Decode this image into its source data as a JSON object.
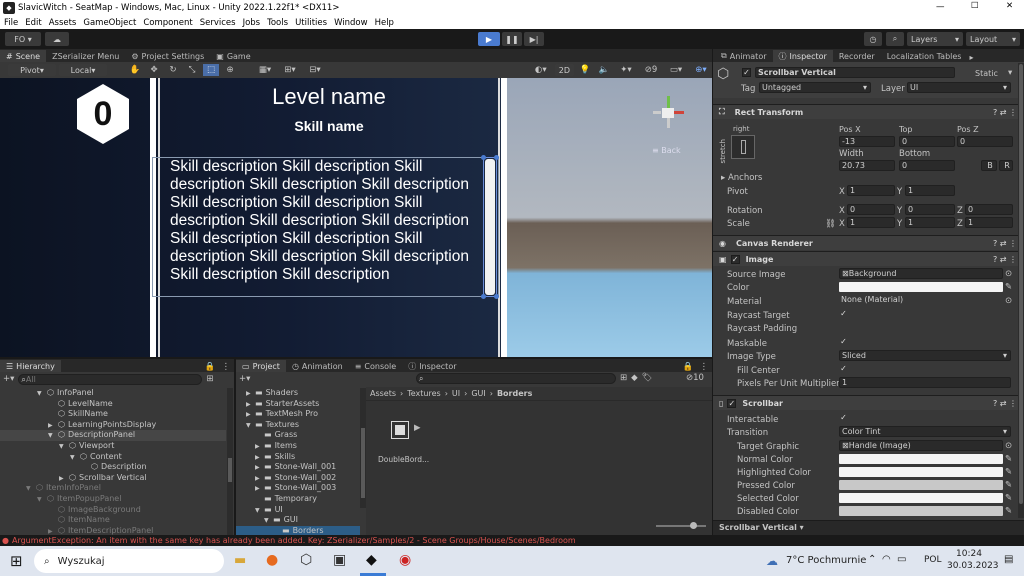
{
  "window": {
    "title": "SlavicWitch - SeatMap - Windows, Mac, Linux - Unity 2022.1.22f1* <DX11>",
    "min": "—",
    "max": "☐",
    "close": "✕"
  },
  "menu": [
    "File",
    "Edit",
    "Assets",
    "GameObject",
    "Component",
    "Services",
    "Jobs",
    "Tools",
    "Utilities",
    "Window",
    "Help"
  ],
  "toolbar": {
    "account": "FO",
    "layers": "Layers",
    "layout": "Layout"
  },
  "scene": {
    "tabs": [
      "Scene",
      "ZSerializer Menu",
      "Project Settings",
      "Game"
    ],
    "pivot": "Pivot",
    "local": "Local",
    "mode2d": "2D",
    "back": "≡ Back",
    "badge": "0",
    "level_name": "Level name",
    "skill_name": "Skill name",
    "description": "Skill description Skill description Skill description Skill description Skill description Skill description Skill description Skill description Skill description Skill description Skill description Skill description Skill description Skill description Skill description Skill description Skill description"
  },
  "inspector": {
    "tabs": [
      "Animator",
      "Inspector",
      "Recorder",
      "Localization Tables"
    ],
    "object_name": "Scrollbar Vertical",
    "static": "Static",
    "tag_label": "Tag",
    "tag": "Untagged",
    "layer_label": "Layer",
    "layer": "UI",
    "rect": {
      "title": "Rect Transform",
      "anchor_h": "right",
      "anchor_v": "stretch",
      "posx_l": "Pos X",
      "top_l": "Top",
      "posz_l": "Pos Z",
      "posx": "-13",
      "top": "0",
      "posz": "0",
      "width_l": "Width",
      "bottom_l": "Bottom",
      "width": "20.73",
      "bottom": "0",
      "anchors": "Anchors",
      "pivot": "Pivot",
      "pivot_x": "1",
      "pivot_y": "1",
      "rotation": "Rotation",
      "rot_x": "0",
      "rot_y": "0",
      "rot_z": "0",
      "scale": "Scale",
      "sc_x": "1",
      "sc_y": "1",
      "sc_z": "1",
      "bp": "B",
      "rp": "R"
    },
    "canvas_renderer": "Canvas Renderer",
    "image": {
      "title": "Image",
      "source_l": "Source Image",
      "source": "Background",
      "color_l": "Color",
      "material_l": "Material",
      "material": "None (Material)",
      "raycast_l": "Raycast Target",
      "padding_l": "Raycast Padding",
      "maskable_l": "Maskable",
      "type_l": "Image Type",
      "type": "Sliced",
      "fill_l": "Fill Center",
      "ppu_l": "Pixels Per Unit Multiplier",
      "ppu": "1"
    },
    "scrollbar": {
      "title": "Scrollbar",
      "interact_l": "Interactable",
      "transition_l": "Transition",
      "transition": "Color Tint",
      "target_l": "Target Graphic",
      "target": "Handle (Image)",
      "normal": "Normal Color",
      "highlighted": "Highlighted Color",
      "pressed": "Pressed Color",
      "selected": "Selected Color",
      "disabled": "Disabled Color"
    },
    "footer": "Scrollbar Vertical ▾"
  },
  "hierarchy": {
    "title": "Hierarchy",
    "search": "All",
    "items": [
      {
        "label": "InfoPanel",
        "indent": 3,
        "arrow": "▼",
        "dim": false
      },
      {
        "label": "LevelName",
        "indent": 4,
        "arrow": "",
        "dim": false
      },
      {
        "label": "SkillName",
        "indent": 4,
        "arrow": "",
        "dim": false
      },
      {
        "label": "LearningPointsDisplay",
        "indent": 4,
        "arrow": "▶",
        "dim": false
      },
      {
        "label": "DescriptionPanel",
        "indent": 4,
        "arrow": "▼",
        "dim": false
      },
      {
        "label": "Viewport",
        "indent": 5,
        "arrow": "▼",
        "dim": false
      },
      {
        "label": "Content",
        "indent": 6,
        "arrow": "▼",
        "dim": false
      },
      {
        "label": "Description",
        "indent": 7,
        "arrow": "",
        "dim": false
      },
      {
        "label": "Scrollbar Vertical",
        "indent": 5,
        "arrow": "▶",
        "dim": false
      },
      {
        "label": "ItemInfoPanel",
        "indent": 2,
        "arrow": "▼",
        "dim": true
      },
      {
        "label": "ItemPopupPanel",
        "indent": 3,
        "arrow": "▼",
        "dim": true
      },
      {
        "label": "ImageBackground",
        "indent": 4,
        "arrow": "",
        "dim": true
      },
      {
        "label": "ItemName",
        "indent": 4,
        "arrow": "",
        "dim": true
      },
      {
        "label": "ItemDescriptionPanel",
        "indent": 4,
        "arrow": "▶",
        "dim": true
      }
    ]
  },
  "project": {
    "tabs": [
      "Project",
      "Animation",
      "Console",
      "Inspector"
    ],
    "tree": [
      {
        "label": "Shaders",
        "indent": 0,
        "arrow": "▶"
      },
      {
        "label": "StarterAssets",
        "indent": 0,
        "arrow": "▶"
      },
      {
        "label": "TextMesh Pro",
        "indent": 0,
        "arrow": "▶"
      },
      {
        "label": "Textures",
        "indent": 0,
        "arrow": "▼"
      },
      {
        "label": "Grass",
        "indent": 1,
        "arrow": ""
      },
      {
        "label": "Items",
        "indent": 1,
        "arrow": "▶"
      },
      {
        "label": "Skills",
        "indent": 1,
        "arrow": "▶"
      },
      {
        "label": "Stone-Wall_001",
        "indent": 1,
        "arrow": "▶"
      },
      {
        "label": "Stone-Wall_002",
        "indent": 1,
        "arrow": "▶"
      },
      {
        "label": "Stone-Wall_003",
        "indent": 1,
        "arrow": "▶"
      },
      {
        "label": "Temporary",
        "indent": 1,
        "arrow": ""
      },
      {
        "label": "UI",
        "indent": 1,
        "arrow": "▼"
      },
      {
        "label": "GUI",
        "indent": 2,
        "arrow": "▼"
      },
      {
        "label": "Borders",
        "indent": 3,
        "arrow": ""
      }
    ],
    "breadcrumb": [
      "Assets",
      "Textures",
      "UI",
      "GUI",
      "Borders"
    ],
    "asset": "DoubleBord...",
    "count": "10"
  },
  "status": {
    "error": "ArgumentException: An item with the same key has already been added. Key: ZSerializer/Samples/2 - Scene Groups/House/Scenes/Bedroom"
  },
  "taskbar": {
    "search": "Wyszukaj",
    "weather": "7°C  Pochmurnie",
    "lang": "POL",
    "time": "10:24",
    "date": "30.03.2023"
  },
  "colors": {
    "accent": "#4a7bd0",
    "error": "#d9534f",
    "unity_bg": "#191919"
  }
}
